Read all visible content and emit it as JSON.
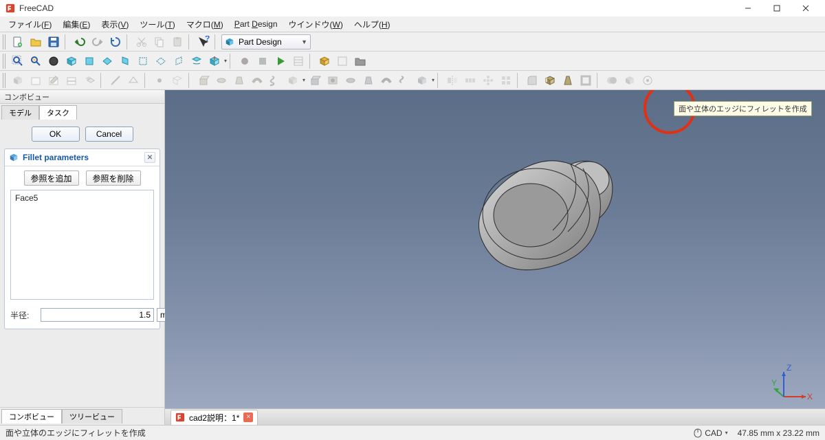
{
  "window": {
    "title": "FreeCAD"
  },
  "window_controls": [
    "minimize",
    "maximize",
    "close"
  ],
  "menu": [
    {
      "label": "ファイル",
      "accel": "F"
    },
    {
      "label": "編集",
      "accel": "E"
    },
    {
      "label": "表示",
      "accel": "V"
    },
    {
      "label": "ツール",
      "accel": "T"
    },
    {
      "label": "マクロ",
      "accel": "M"
    },
    {
      "label": "Part Design",
      "accel": ""
    },
    {
      "label": "ウインドウ",
      "accel": "W"
    },
    {
      "label": "ヘルプ",
      "accel": "H"
    }
  ],
  "workbench": {
    "selected": "Part Design"
  },
  "toolbars": {
    "row1_groups": [
      [
        "new",
        "open",
        "save"
      ],
      [
        "undo",
        "redo",
        "refresh"
      ],
      [
        "cut",
        "copy",
        "paste"
      ],
      [
        "whatsthis"
      ]
    ],
    "row2_groups": [
      [
        "fit-all",
        "fit-selection",
        "draw-style",
        "view-iso",
        "view-front",
        "view-top",
        "view-right",
        "view-back",
        "view-bottom",
        "view-left",
        "view-rotate",
        "view-group"
      ],
      [
        "macro-record",
        "macro-stop",
        "macro-play",
        "macro-edit"
      ],
      [
        "part",
        "group",
        "folder"
      ]
    ],
    "row3_groups": [
      [
        "create-body",
        "create-sketch",
        "edit-sketch",
        "map-sketch"
      ],
      [
        "create-line",
        "create-arc",
        "create-point"
      ],
      [
        "pad",
        "revolution",
        "loft",
        "sweep",
        "additive-helix",
        "additive-primitive",
        "pocket",
        "hole",
        "groove",
        "subtractive-loft",
        "subtractive-sweep",
        "subtractive-helix",
        "subtractive-primitive"
      ],
      [
        "mirror",
        "linear-pattern",
        "polar-pattern",
        "multi-transform"
      ],
      [
        "fillet",
        "chamfer",
        "draft",
        "thickness"
      ],
      [
        "boolean",
        "migrate",
        "shape-binder",
        "subshape-binder",
        "clone"
      ]
    ]
  },
  "red_circle_hint": "面や立体のエッジにフィレットを作成",
  "left_panel": {
    "combo_title": "コンボビュー",
    "tabs": {
      "model": "モデル",
      "task": "タスク",
      "active": "task"
    },
    "ok": "OK",
    "cancel": "Cancel",
    "fillet": {
      "title": "Fillet parameters",
      "add_ref": "参照を追加",
      "del_ref": "参照を削除",
      "refs": [
        "Face5"
      ],
      "radius_label": "半径:",
      "radius_value": "1.5",
      "radius_unit": "mm"
    },
    "bottom_tabs": {
      "combo": "コンボビュー",
      "tree": "ツリービュー"
    }
  },
  "document_tab": {
    "label": "cad2説明：1*",
    "dirty": true
  },
  "status": {
    "hint": "面や立体のエッジにフィレットを作成",
    "navstyle": "CAD",
    "coords": "47.85 mm x 23.22 mm"
  },
  "triad_labels": [
    "X",
    "Y",
    "Z"
  ]
}
